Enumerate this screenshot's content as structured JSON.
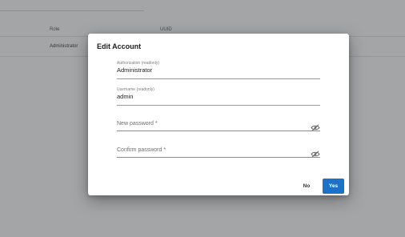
{
  "background": {
    "columns": [
      "Role",
      "UUID"
    ],
    "rows": [
      {
        "role": "Administrator",
        "uuid": ""
      }
    ]
  },
  "dialog": {
    "title": "Edit Account",
    "authorization": {
      "label": "Authorization (readonly)",
      "value": "Administrator"
    },
    "username": {
      "label": "Username (readonly)",
      "value": "admin"
    },
    "new_password": {
      "placeholder": "New password *",
      "toggle_icon": "eye-off-icon"
    },
    "confirm_password": {
      "placeholder": "Confirm password *",
      "toggle_icon": "eye-off-icon"
    },
    "no_label": "No",
    "yes_label": "Yes"
  },
  "colors": {
    "primary": "#1a73c8",
    "overlay": "rgba(50,55,60,0.45)"
  }
}
